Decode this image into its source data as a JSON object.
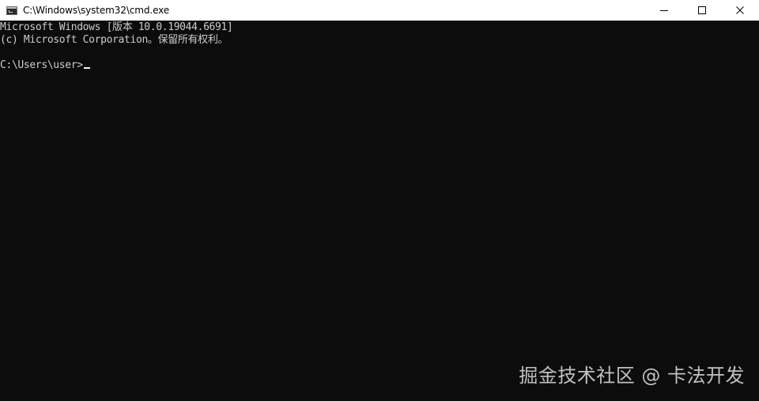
{
  "window": {
    "title": "C:\\Windows\\system32\\cmd.exe",
    "icon": "cmd-console-icon",
    "controls": {
      "minimize": "minimize-icon",
      "maximize": "maximize-icon",
      "close": "close-icon"
    }
  },
  "console": {
    "lines": [
      "Microsoft Windows [版本 10.0.19044.6691]",
      "(c) Microsoft Corporation。保留所有权利。",
      "",
      "C:\\Users\\user>"
    ],
    "colors": {
      "background": "#0c0c0c",
      "text": "#cccccc"
    }
  },
  "watermark": {
    "text": "掘金技术社区 @ 卡法开发"
  }
}
